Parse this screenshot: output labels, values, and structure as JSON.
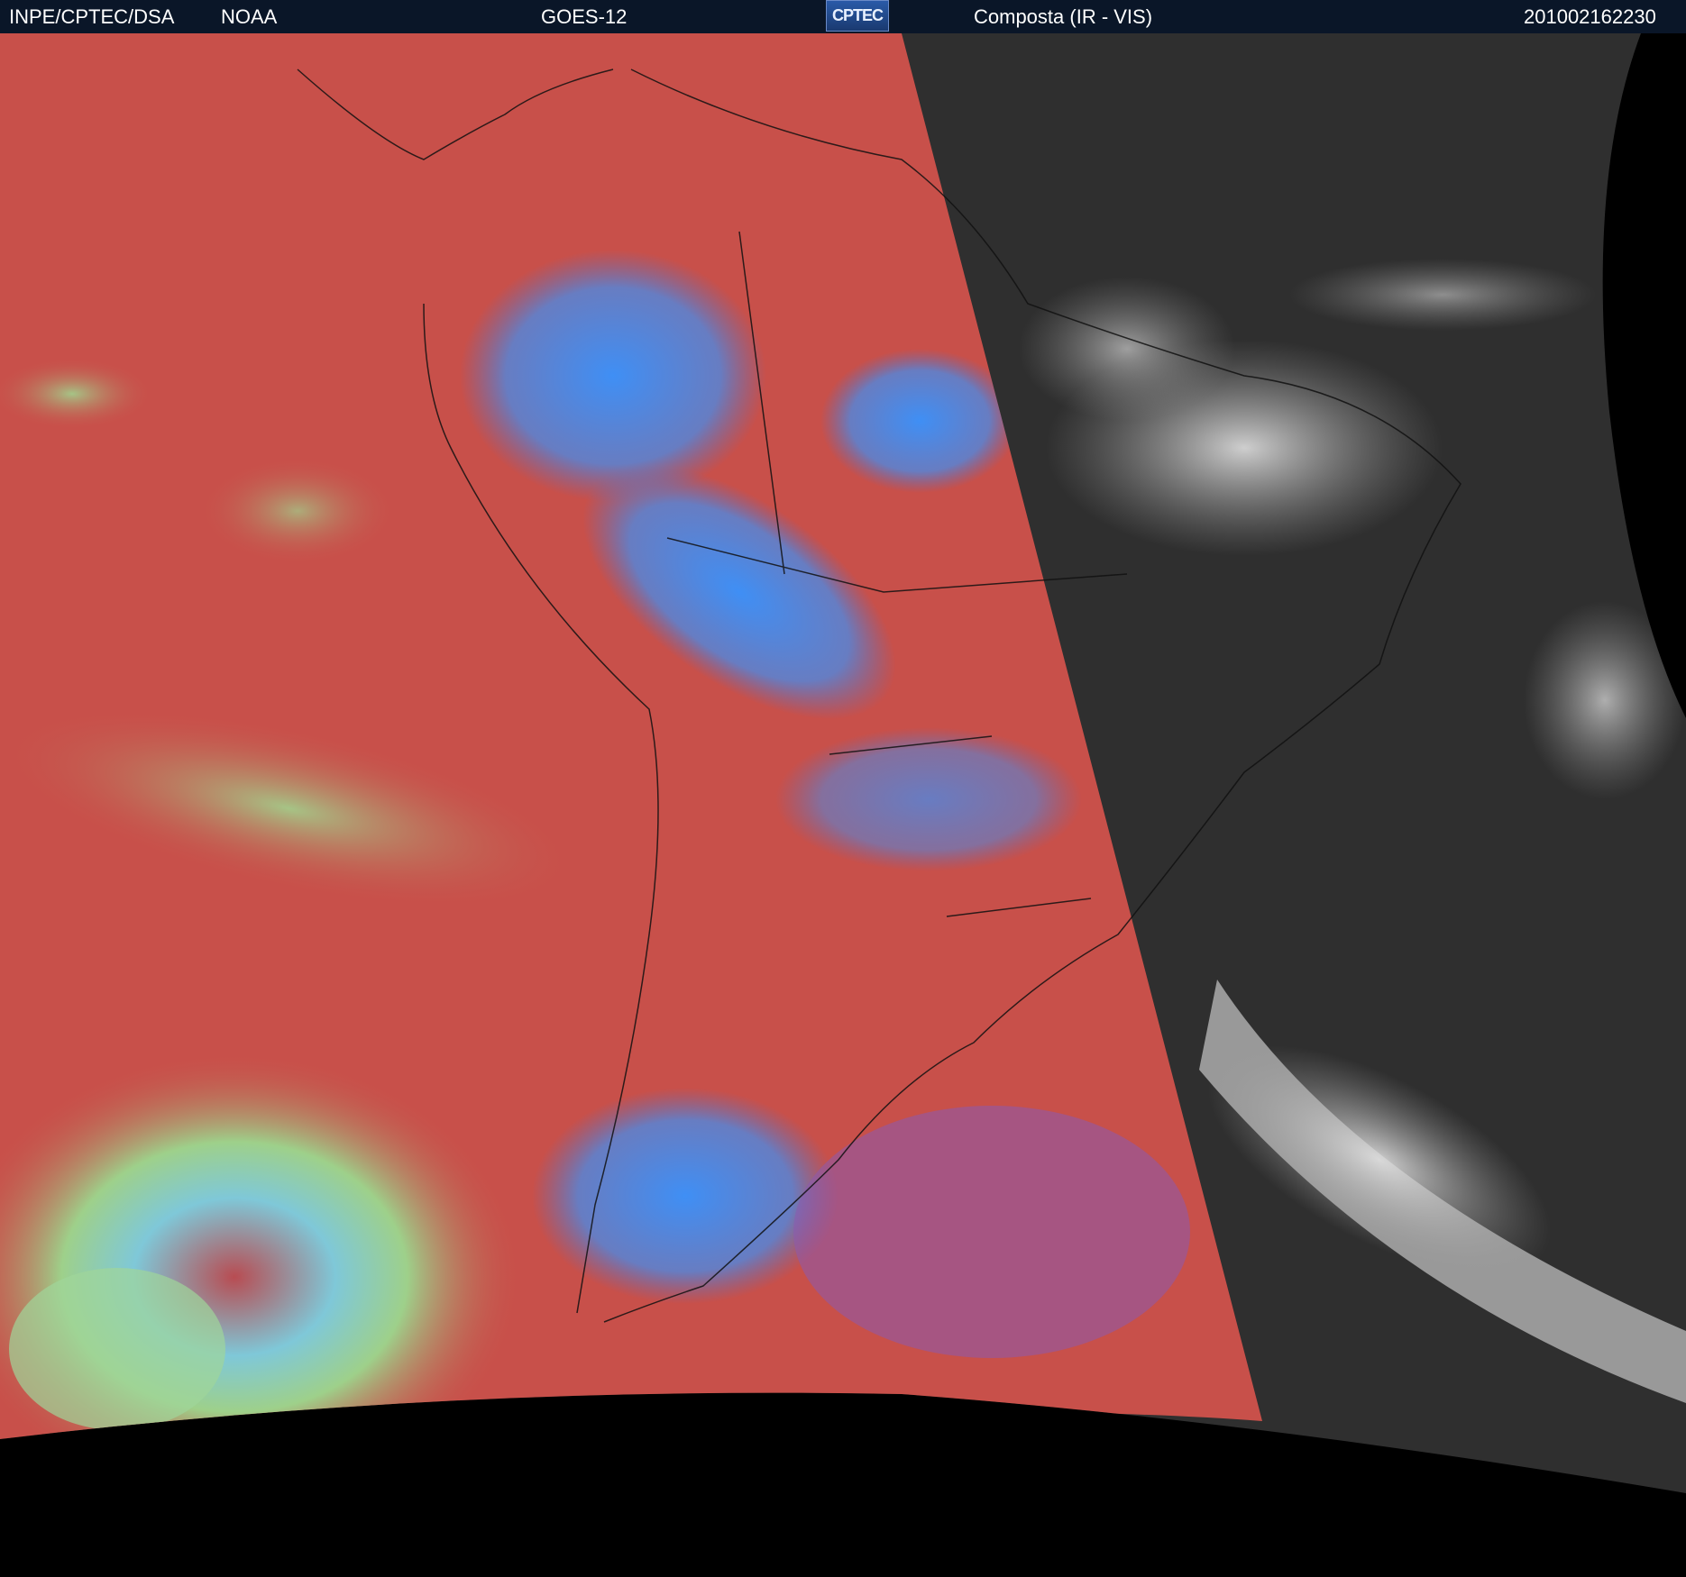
{
  "header": {
    "agency": "INPE/CPTEC/DSA",
    "partner": "NOAA",
    "satellite": "GOES-12",
    "logo_text": "CPTEC",
    "product": "Composta (IR - VIS)",
    "timestamp": "201002162230"
  },
  "colors": {
    "ir_ocean": "#c8504a",
    "ir_cloud_high": "#3b8cf0",
    "ir_cloud_mid": "#8cc47a",
    "vis_background": "#2e2e2e",
    "vis_cloud": "#d8d8d8",
    "space": "#000000"
  }
}
